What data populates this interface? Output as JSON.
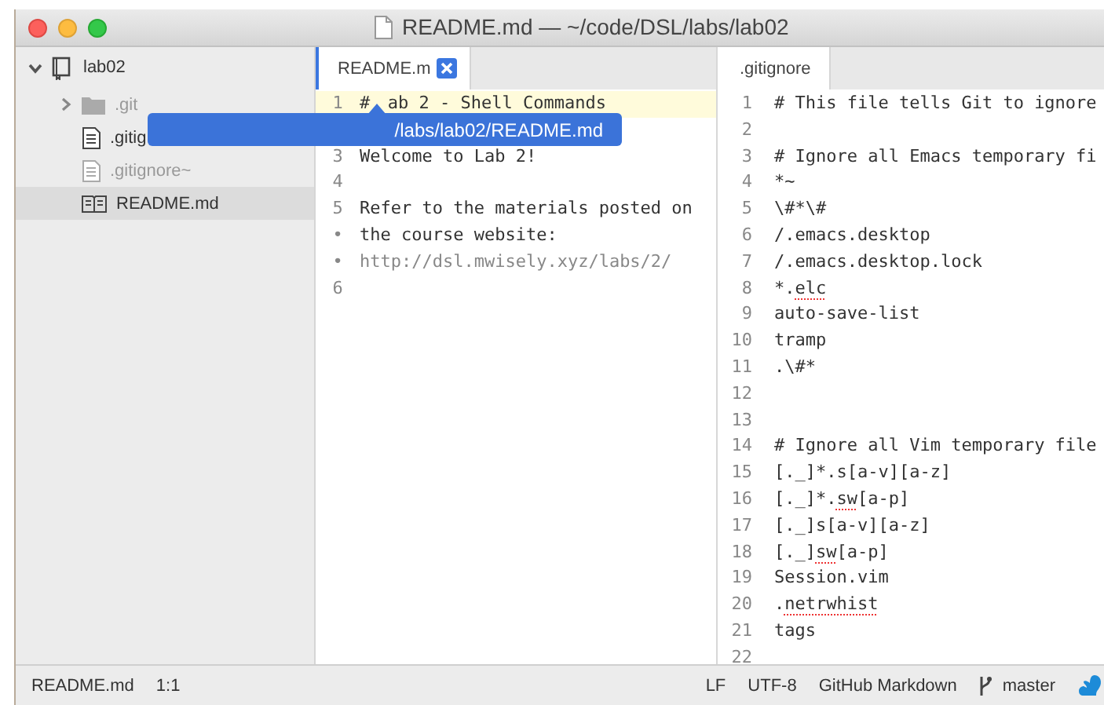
{
  "window": {
    "title": "README.md — ~/code/DSL/labs/lab02"
  },
  "sidebar": {
    "root": {
      "label": "lab02",
      "expanded": true,
      "children": [
        {
          "label": ".git",
          "kind": "folder",
          "expanded": false,
          "ignored": true,
          "selected": false
        },
        {
          "label": ".gitig",
          "kind": "file",
          "ignored": false,
          "selected": false
        },
        {
          "label": ".gitignore~",
          "kind": "file",
          "ignored": true,
          "selected": false
        },
        {
          "label": "README.md",
          "kind": "readme",
          "ignored": false,
          "selected": true
        }
      ]
    }
  },
  "tooltip": {
    "text": "/labs/lab02/README.md"
  },
  "panes": [
    {
      "tab": {
        "label": "README.m",
        "selected": true,
        "closable": true
      },
      "lines": [
        {
          "gutter": "1",
          "current": true,
          "segments": [
            {
              "text": "#"
            },
            {
              "text": "ab 2 - Shell Commands",
              "gap_before": true
            }
          ]
        },
        {
          "covered": true
        },
        {
          "gutter": "3",
          "segments": [
            {
              "text": "Welcome to Lab 2!"
            }
          ]
        },
        {
          "gutter": "4"
        },
        {
          "gutter": "5",
          "segments": [
            {
              "text": "Refer to the materials posted on"
            }
          ]
        },
        {
          "gutter": "•",
          "segments": [
            {
              "text": "the course website:"
            }
          ]
        },
        {
          "gutter": "•",
          "segments": [
            {
              "text": "http://dsl.mwisely.xyz/labs/2/",
              "muted": true
            }
          ]
        },
        {
          "gutter": "6"
        }
      ]
    },
    {
      "tab": {
        "label": ".gitignore",
        "selected": true,
        "closable": false
      },
      "lines": [
        {
          "gutter": "1",
          "segments": [
            {
              "text": "# This file tells Git to ignore"
            }
          ]
        },
        {
          "gutter": "2"
        },
        {
          "gutter": "3",
          "segments": [
            {
              "text": "# Ignore all Emacs temporary fi"
            }
          ]
        },
        {
          "gutter": "4",
          "segments": [
            {
              "text": "*~"
            }
          ]
        },
        {
          "gutter": "5",
          "segments": [
            {
              "text": "\\#*\\#"
            }
          ]
        },
        {
          "gutter": "6",
          "segments": [
            {
              "text": "/.emacs.desktop"
            }
          ]
        },
        {
          "gutter": "7",
          "segments": [
            {
              "text": "/.emacs.desktop.lock"
            }
          ]
        },
        {
          "gutter": "8",
          "segments": [
            {
              "text": "*."
            },
            {
              "text": "elc",
              "misspelled": true
            }
          ]
        },
        {
          "gutter": "9",
          "segments": [
            {
              "text": "auto-save-list"
            }
          ]
        },
        {
          "gutter": "10",
          "segments": [
            {
              "text": "tramp"
            }
          ]
        },
        {
          "gutter": "11",
          "segments": [
            {
              "text": ".\\#*"
            }
          ]
        },
        {
          "gutter": "12"
        },
        {
          "gutter": "13"
        },
        {
          "gutter": "14",
          "segments": [
            {
              "text": "# Ignore all Vim temporary file"
            }
          ]
        },
        {
          "gutter": "15",
          "segments": [
            {
              "text": "[._]*.s[a-v][a-z]"
            }
          ]
        },
        {
          "gutter": "16",
          "segments": [
            {
              "text": "[._]*."
            },
            {
              "text": "sw",
              "misspelled": true
            },
            {
              "text": "[a-p]"
            }
          ]
        },
        {
          "gutter": "17",
          "segments": [
            {
              "text": "[._]s[a-v][a-z]"
            }
          ]
        },
        {
          "gutter": "18",
          "segments": [
            {
              "text": "[._]"
            },
            {
              "text": "sw",
              "misspelled": true
            },
            {
              "text": "[a-p]"
            }
          ]
        },
        {
          "gutter": "19",
          "segments": [
            {
              "text": "Session.vim"
            }
          ]
        },
        {
          "gutter": "20",
          "segments": [
            {
              "text": "."
            },
            {
              "text": "netrwhist",
              "misspelled": true
            }
          ]
        },
        {
          "gutter": "21",
          "segments": [
            {
              "text": "tags"
            }
          ]
        },
        {
          "gutter": "22"
        }
      ]
    }
  ],
  "status_bar": {
    "left": [
      "README.md",
      "1:1"
    ],
    "right": [
      {
        "text": "LF",
        "kind": "plain"
      },
      {
        "text": "UTF-8",
        "kind": "plain"
      },
      {
        "text": "GitHub Markdown",
        "kind": "plain"
      },
      {
        "text": "master",
        "kind": "branch"
      }
    ]
  }
}
